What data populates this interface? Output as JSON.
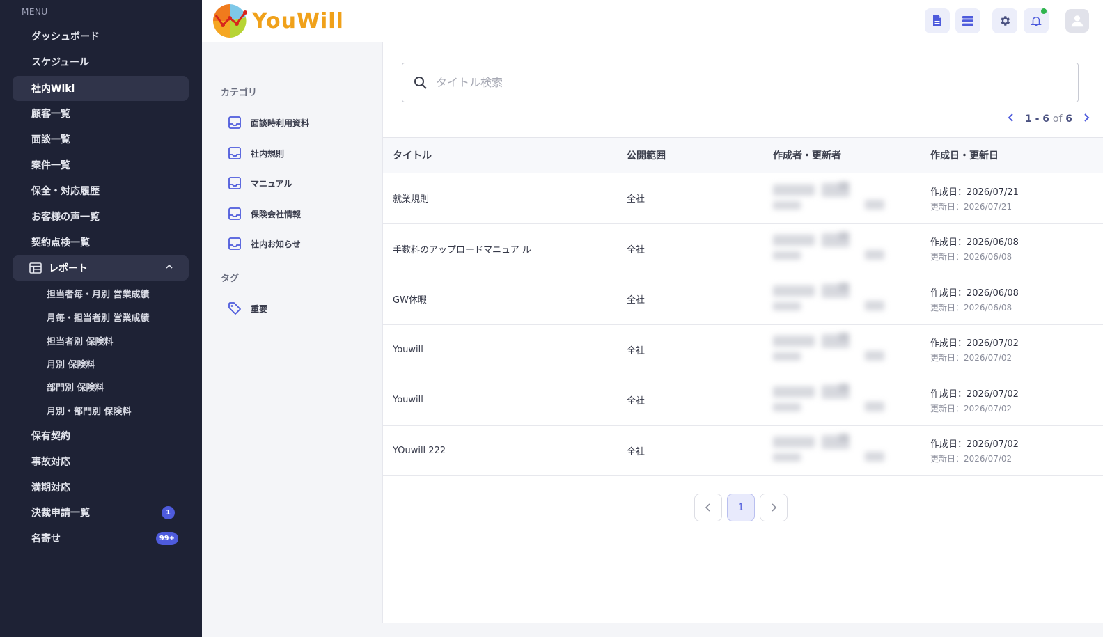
{
  "sidebar": {
    "menu_label": "MENU",
    "items": [
      {
        "label": "ダッシュボード"
      },
      {
        "label": "スケジュール"
      },
      {
        "label": "社内Wiki"
      },
      {
        "label": "顧客一覧"
      },
      {
        "label": "面談一覧"
      },
      {
        "label": "案件一覧"
      },
      {
        "label": "保全・対応履歴"
      },
      {
        "label": "お客様の声一覧"
      },
      {
        "label": "契約点検一覧"
      }
    ],
    "report": {
      "label": "レポート",
      "subitems": [
        {
          "label": "担当者毎・月別 営業成績"
        },
        {
          "label": "月毎・担当者別 営業成績"
        },
        {
          "label": "担当者別 保険料"
        },
        {
          "label": "月別 保険料"
        },
        {
          "label": "部門別 保険料"
        },
        {
          "label": "月別・部門別 保険料"
        }
      ]
    },
    "items_after": [
      {
        "label": "保有契約"
      },
      {
        "label": "事故対応"
      },
      {
        "label": "満期対応"
      },
      {
        "label": "決裁申請一覧",
        "badge": "1"
      },
      {
        "label": "名寄せ",
        "badge": "99+"
      }
    ],
    "active_item": "社内Wiki"
  },
  "header": {
    "logo_text": "YouWill"
  },
  "panel": {
    "category_heading": "カテゴリ",
    "categories": [
      {
        "label": "面談時利用資料"
      },
      {
        "label": "社内規則"
      },
      {
        "label": "マニュアル"
      },
      {
        "label": "保険会社情報"
      },
      {
        "label": "社内お知らせ"
      }
    ],
    "tag_heading": "タグ",
    "tags": [
      {
        "label": "重要"
      }
    ]
  },
  "main": {
    "search_placeholder": "タイトル検索",
    "pagination_top": {
      "range": "1 - 6",
      "of": "of",
      "total": "6"
    },
    "table": {
      "headers": [
        "タイトル",
        "公開範囲",
        "作成者・更新者",
        "作成日・更新日"
      ],
      "rows": [
        {
          "title": "就業規則",
          "scope": "全社",
          "created": "作成日：2026/07/21",
          "updated": "更新日：2026/07/21"
        },
        {
          "title": "手数料のアップロードマニュア ル",
          "scope": "全社",
          "created": "作成日：2026/06/08",
          "updated": "更新日：2026/06/08"
        },
        {
          "title": "GW休暇",
          "scope": "全社",
          "created": "作成日：2026/06/08",
          "updated": "更新日：2026/06/08"
        },
        {
          "title": "Youwill",
          "scope": "全社",
          "created": "作成日：2026/07/02",
          "updated": "更新日：2026/07/02"
        },
        {
          "title": "Youwill",
          "scope": "全社",
          "created": "作成日：2026/07/02",
          "updated": "更新日：2026/07/02"
        },
        {
          "title": "YOuwill 222",
          "scope": "全社",
          "created": "作成日：2026/07/02",
          "updated": "更新日：2026/07/02"
        }
      ]
    },
    "pagination_bottom": {
      "current_page": "1"
    }
  },
  "colors": {
    "sidebar_bg": "#1e2235",
    "accent": "#4e5bdc",
    "logo": "#f0a11a"
  }
}
